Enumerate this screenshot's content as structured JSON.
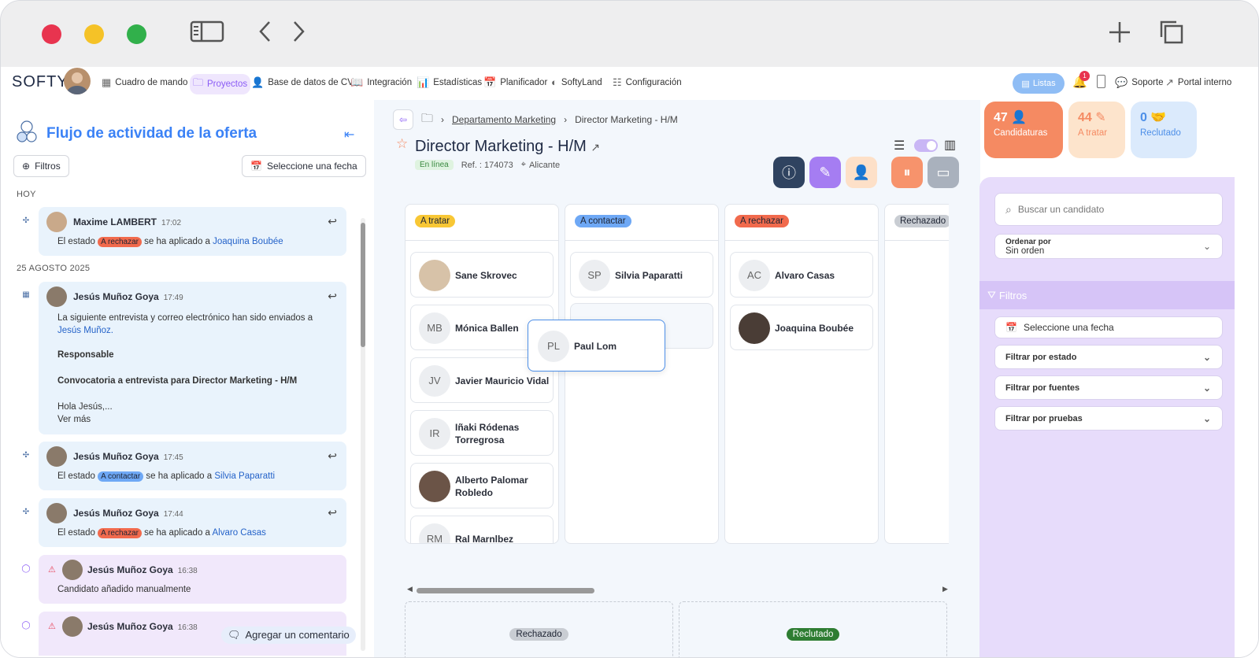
{
  "titlebar": {
    "icons": [
      "sidebar-icon",
      "back-icon",
      "forward-icon",
      "plus-icon",
      "copy-icon"
    ]
  },
  "nav": {
    "logo": "SOFTY",
    "items": [
      {
        "label": "Cuadro de mando",
        "icon": "grid-icon"
      },
      {
        "label": "Proyectos",
        "icon": "folder-icon"
      },
      {
        "label": "Base de datos de CV",
        "icon": "users-icon"
      },
      {
        "label": "Integración",
        "icon": "book-icon"
      },
      {
        "label": "Estadísticas",
        "icon": "chart-icon"
      },
      {
        "label": "Planificador",
        "icon": "calendar-icon"
      },
      {
        "label": "SoftyLand",
        "icon": "softyland-icon"
      },
      {
        "label": "Configuración",
        "icon": "settings-icon"
      }
    ],
    "listas": "Listas",
    "notif_count": "1",
    "soporte": "Soporte",
    "portal": "Portal interno"
  },
  "activity": {
    "title": "Flujo de actividad de la oferta",
    "filters": "Filtros",
    "date_btn": "Seleccione una fecha",
    "today": "HOY",
    "date2": "25 AGOSTO 2025",
    "add_comment": "Agregar un comentario",
    "entries": [
      {
        "name": "Maxime LAMBERT",
        "time": "17:02",
        "pre": "El estado",
        "badge": "A rechazar",
        "mid": "se ha aplicado a",
        "target": "Joaquina Boubée"
      },
      {
        "name": "Jesús Muñoz Goya",
        "time": "17:49",
        "line1": "La siguiente entrevista y correo electrónico han sido enviados a",
        "line1b": "Jesús Muñoz.",
        "resp": "Responsable",
        "conv": "Convocatoria a entrevista para Director Marketing - H/M",
        "hola": "Hola Jesús,...",
        "more": "Ver más"
      },
      {
        "name": "Jesús Muñoz Goya",
        "time": "17:45",
        "pre": "El estado",
        "badge": "A contactar",
        "mid": "se ha aplicado a",
        "target": "Silvia Paparatti"
      },
      {
        "name": "Jesús Muñoz Goya",
        "time": "17:44",
        "pre": "El estado",
        "badge": "A rechazar",
        "mid": "se ha aplicado a",
        "target": "Alvaro Casas"
      },
      {
        "name": "Jesús Muñoz Goya",
        "time": "16:38",
        "text": "Candidato añadido manualmente"
      },
      {
        "name": "Jesús Muñoz Goya",
        "time": "16:38"
      }
    ]
  },
  "job": {
    "crumb1": "Departamento Marketing",
    "crumb2": "Director Marketing - H/M",
    "title": "Director Marketing - H/M",
    "status": "En línea",
    "ref": "Ref. : 174073",
    "location": "Alicante"
  },
  "stats": [
    {
      "num": "47",
      "label": "Candidaturas"
    },
    {
      "num": "44",
      "label": "A tratar"
    },
    {
      "num": "0",
      "label": "Reclutado"
    }
  ],
  "columns": [
    {
      "label": "A tratar",
      "cards": [
        {
          "ini": "",
          "name": "Sane Skrovec"
        },
        {
          "ini": "MB",
          "name": "Mónica Ballen"
        },
        {
          "ini": "JV",
          "name": "Javier Mauricio Vidal"
        },
        {
          "ini": "IR",
          "name": "Iñaki Ródenas Torregrosa"
        },
        {
          "ini": "",
          "name": "Alberto Palomar Robledo"
        },
        {
          "ini": "RM",
          "name": "Ral Marnlbez"
        }
      ]
    },
    {
      "label": "A contactar",
      "cards": [
        {
          "ini": "SP",
          "name": "Silvia Paparatti"
        }
      ]
    },
    {
      "label": "A rechazar",
      "cards": [
        {
          "ini": "AC",
          "name": "Alvaro Casas"
        },
        {
          "ini": "",
          "name": "Joaquina Boubée"
        }
      ]
    },
    {
      "label": "Rechazado",
      "cards": []
    }
  ],
  "dragging": {
    "ini": "PL",
    "name": "Paul Lom"
  },
  "dropzones": [
    "Rechazado",
    "Reclutado"
  ],
  "filters_panel": {
    "search_placeholder": "Buscar un candidato",
    "order_label": "Ordenar por",
    "order_value": "Sin orden",
    "title": "Filtros",
    "date": "Seleccione una fecha",
    "by_state": "Filtrar por estado",
    "by_source": "Filtrar por fuentes",
    "by_tests": "Filtrar por pruebas"
  },
  "colors": {
    "accent": "#3b82f6",
    "purple": "#8b5cf6",
    "orange": "#f58a62",
    "red": "#e84a5f"
  }
}
